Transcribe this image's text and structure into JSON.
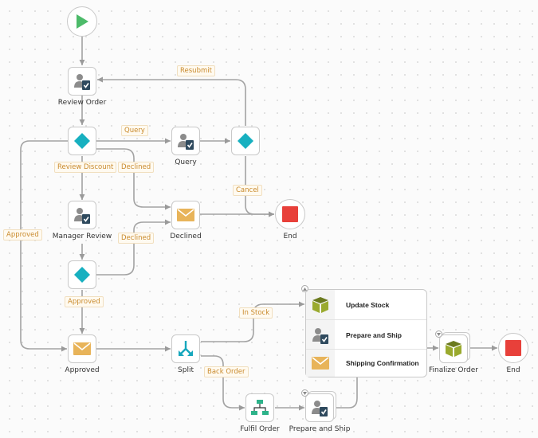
{
  "diagram": {
    "nodes": {
      "start": {
        "type": "start-event",
        "icon": "play-icon",
        "color": "#4dbb6a"
      },
      "review_order": {
        "label": "Review Order",
        "icon": "user-task-icon"
      },
      "gateway_1": {
        "icon": "gateway-diamond-icon",
        "color": "#17b0c0"
      },
      "query": {
        "label": "Query",
        "icon": "user-task-icon"
      },
      "gateway_query": {
        "icon": "gateway-diamond-icon",
        "color": "#17b0c0"
      },
      "manager_review": {
        "label": "Manager Review",
        "icon": "user-task-icon"
      },
      "declined": {
        "label": "Declined",
        "icon": "mail-icon",
        "color": "#e8b45a"
      },
      "end_1": {
        "label": "End",
        "icon": "stop-icon",
        "color": "#e8403a"
      },
      "gateway_2": {
        "icon": "gateway-diamond-icon",
        "color": "#17b0c0"
      },
      "approved": {
        "label": "Approved",
        "icon": "mail-icon",
        "color": "#e8b45a"
      },
      "split": {
        "label": "Split",
        "icon": "split-icon",
        "color": "#17a7bd"
      },
      "fulfil_order": {
        "label": "Fulfil Order",
        "icon": "org-chart-icon",
        "color": "#2db38a"
      },
      "prepare_ship_2": {
        "label": "Prepare and Ship",
        "icon": "user-task-icon"
      },
      "finalize_order": {
        "label": "Finalize Order",
        "icon": "box-icon",
        "color": "#8a9a2a"
      },
      "end_2": {
        "label": "End",
        "icon": "stop-icon",
        "color": "#e8403a"
      }
    },
    "group": {
      "items": [
        {
          "label": "Update Stock",
          "icon": "box-icon"
        },
        {
          "label": "Prepare and Ship",
          "icon": "user-task-icon"
        },
        {
          "label": "Shipping Confirmation",
          "icon": "mail-icon"
        }
      ]
    },
    "edge_labels": {
      "resubmit": "Resubmit",
      "query": "Query",
      "review_discount": "Review Discount",
      "declined_1": "Declined",
      "cancel": "Cancel",
      "approved_left": "Approved",
      "declined_2": "Declined",
      "approved_2": "Approved",
      "in_stock": "In Stock",
      "back_order": "Back Order"
    },
    "colors": {
      "connector": "#9a9a9a",
      "edge_label_text": "#c98a2c"
    }
  }
}
